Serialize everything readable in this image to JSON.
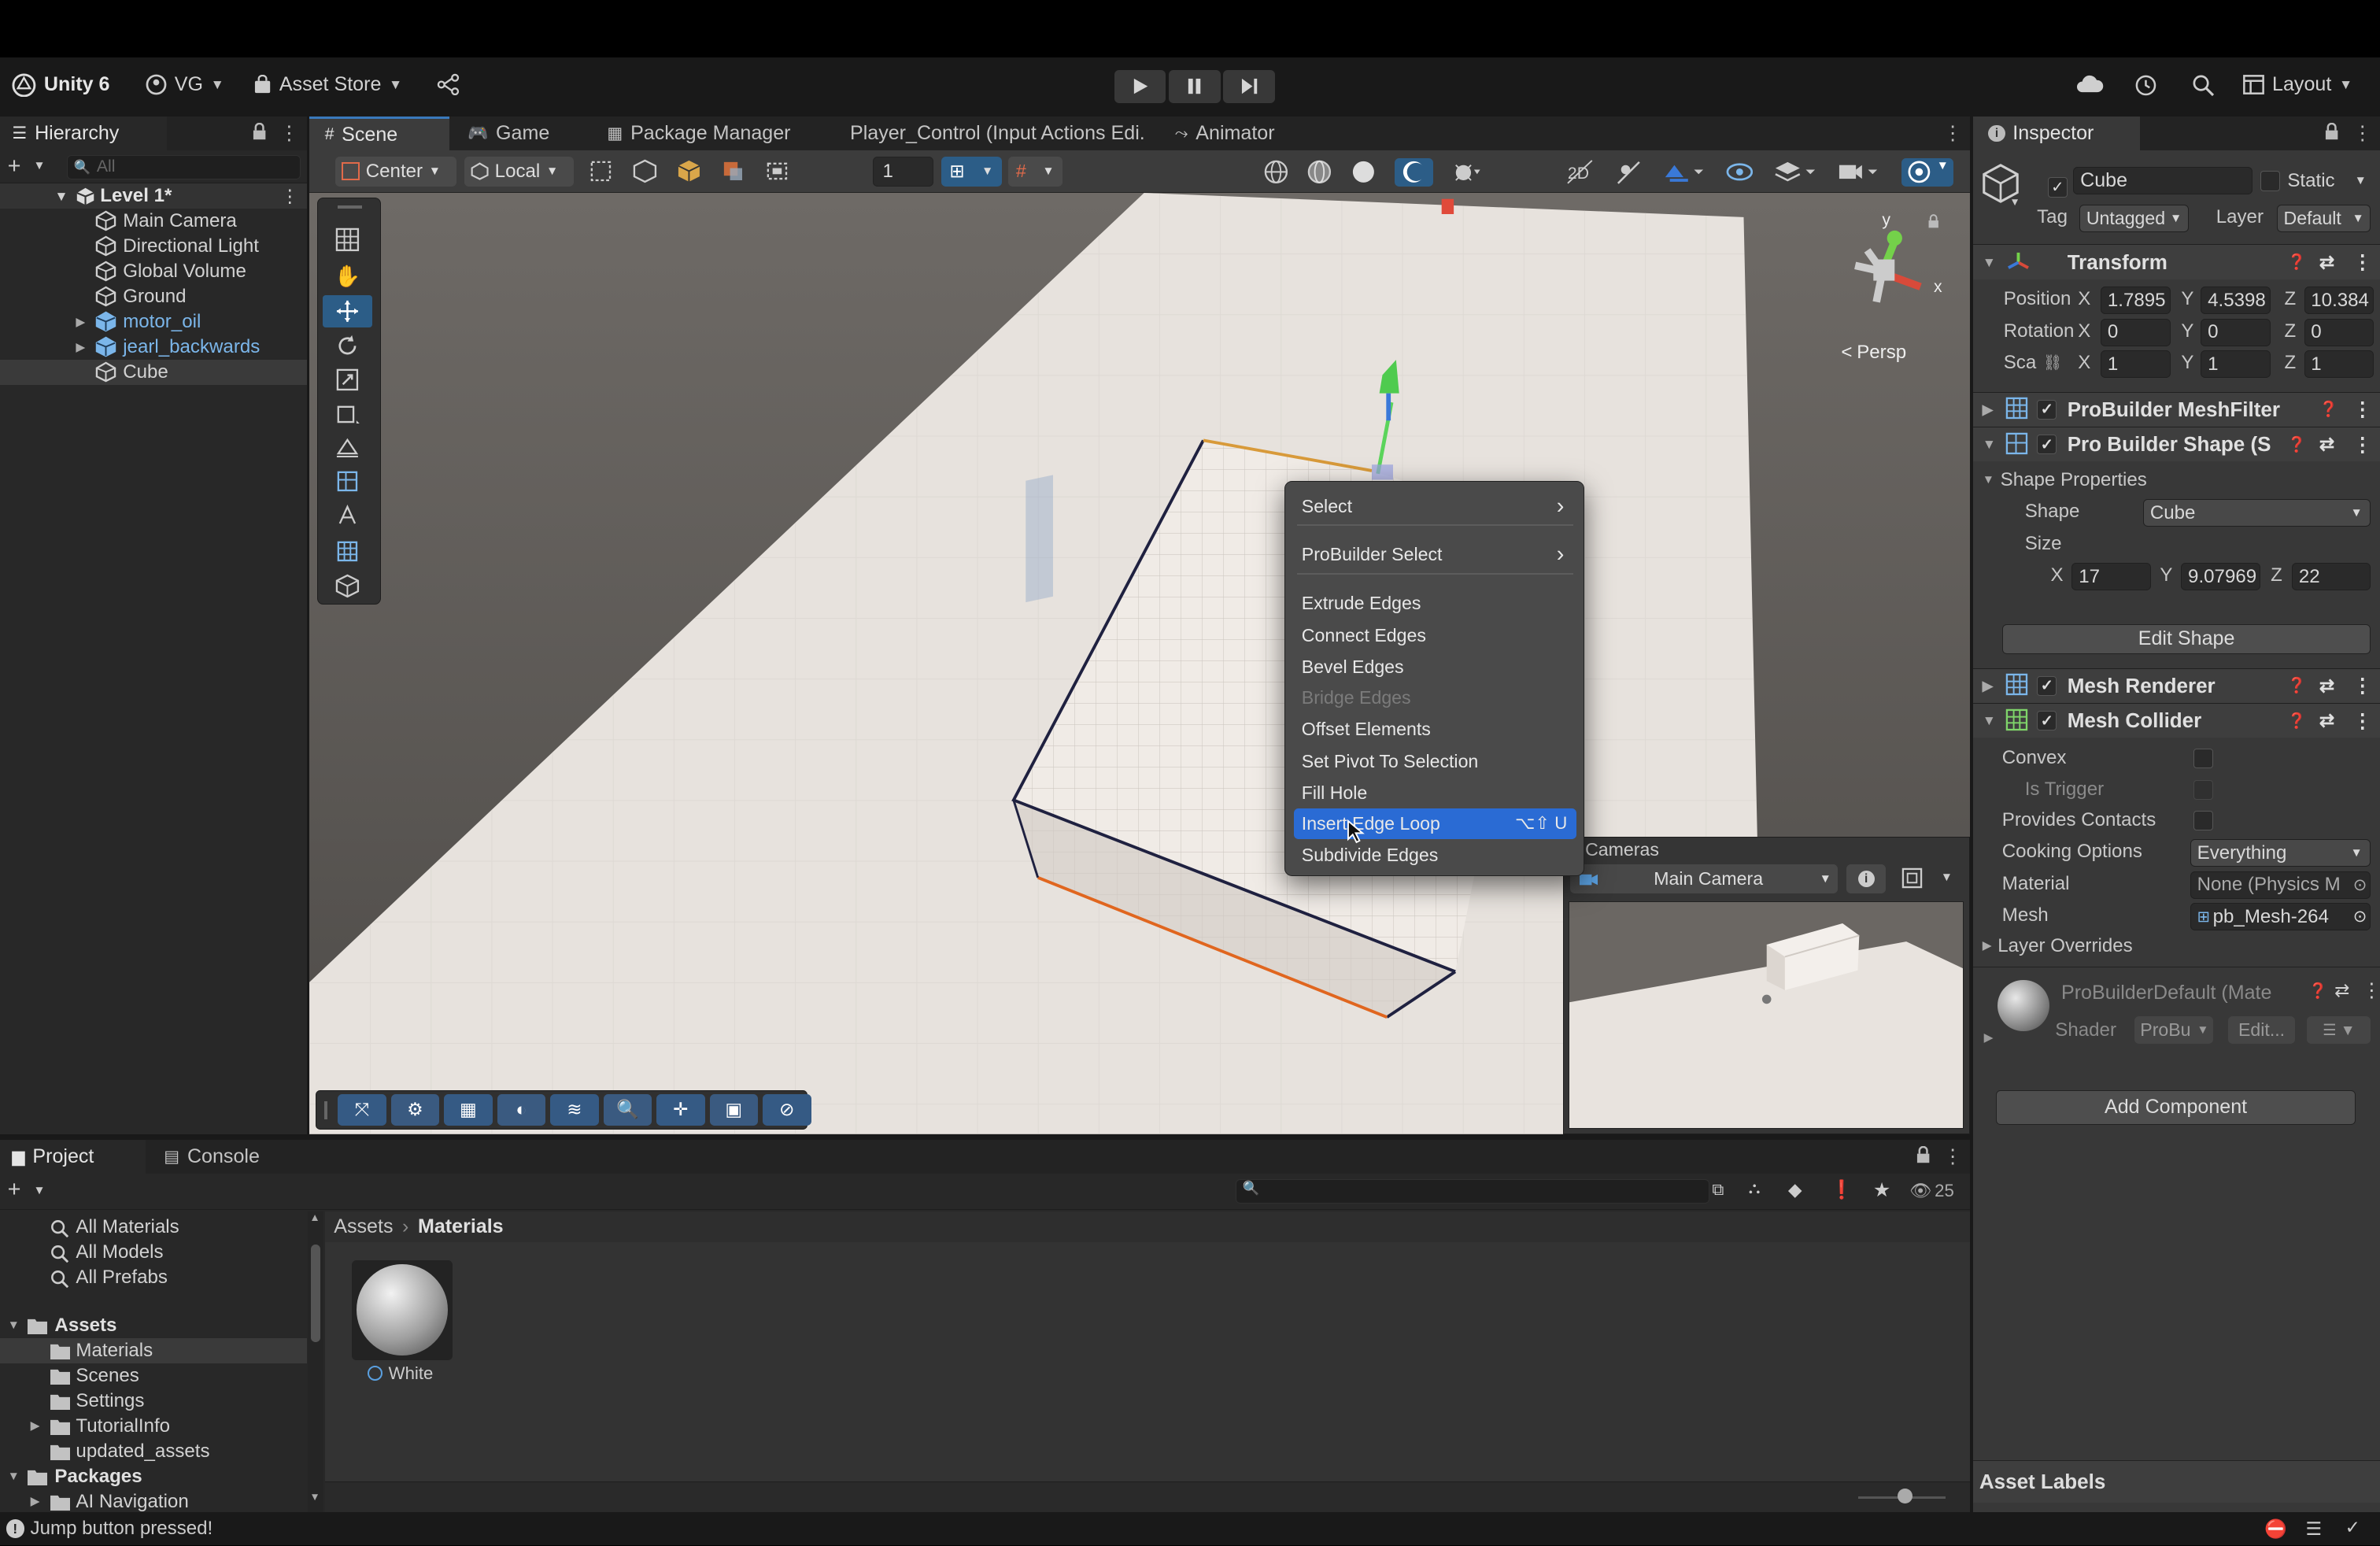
{
  "toolbar": {
    "unity": "Unity 6",
    "account": "VG",
    "asset_store": "Asset Store",
    "layout": "Layout"
  },
  "hierarchy": {
    "title": "Hierarchy",
    "search_placeholder": "All",
    "scene": "Level 1*",
    "items": [
      {
        "label": "Main Camera",
        "prefab": false,
        "expandable": false
      },
      {
        "label": "Directional Light",
        "prefab": false,
        "expandable": false
      },
      {
        "label": "Global Volume",
        "prefab": false,
        "expandable": false
      },
      {
        "label": "Ground",
        "prefab": false,
        "expandable": false
      },
      {
        "label": "motor_oil",
        "prefab": true,
        "expandable": true
      },
      {
        "label": "jearl_backwards",
        "prefab": true,
        "expandable": true
      },
      {
        "label": "Cube",
        "prefab": false,
        "expandable": false,
        "selected": true
      }
    ]
  },
  "tabs": [
    "Scene",
    "Game",
    "Package Manager",
    "Player_Control (Input Actions Edi.",
    "Animator"
  ],
  "scene_toolbar": {
    "pivot": "Center",
    "space": "Local",
    "snap_value": "1"
  },
  "scene": {
    "persp": "Persp",
    "axes": {
      "y": "y",
      "x": "x"
    }
  },
  "context_menu": {
    "items": [
      {
        "label": "Select",
        "submenu": true
      },
      {
        "label": "ProBuilder Select",
        "submenu": true
      },
      {
        "label": "Extrude Edges"
      },
      {
        "label": "Connect Edges"
      },
      {
        "label": "Bevel Edges"
      },
      {
        "label": "Bridge Edges",
        "disabled": true
      },
      {
        "label": "Offset Elements"
      },
      {
        "label": "Set Pivot To Selection"
      },
      {
        "label": "Fill Hole"
      },
      {
        "label": "Insert Edge Loop",
        "shortcut": "⌥⇧ U",
        "highlighted": true
      },
      {
        "label": "Subdivide Edges"
      }
    ]
  },
  "cameras_overlay": {
    "title": "Cameras",
    "camera": "Main Camera"
  },
  "inspector": {
    "title": "Inspector",
    "object_name": "Cube",
    "static": "Static",
    "tag_label": "Tag",
    "tag": "Untagged",
    "layer_label": "Layer",
    "layer": "Default",
    "transform": {
      "title": "Transform",
      "position_label": "Position",
      "rotation_label": "Rotation",
      "scale_label": "Sca",
      "position": {
        "x": "1.7895",
        "y": "4.5398",
        "z": "10.384"
      },
      "rotation": {
        "x": "0",
        "y": "0",
        "z": "0"
      },
      "scale": {
        "x": "1",
        "y": "1",
        "z": "1"
      }
    },
    "meshfilter": "ProBuilder MeshFilter",
    "pbshape": "Pro Builder Shape (S",
    "shape_properties": "Shape Properties",
    "shape_label": "Shape",
    "shape": "Cube",
    "size_label": "Size",
    "size": {
      "x": "17",
      "y": "9.07969",
      "z": "22"
    },
    "edit_shape": "Edit Shape",
    "mesh_renderer": "Mesh Renderer",
    "mesh_collider": "Mesh Collider",
    "convex": "Convex",
    "is_trigger": "Is Trigger",
    "provides_contacts": "Provides Contacts",
    "cooking_options_label": "Cooking Options",
    "cooking_options": "Everything",
    "material_label": "Material",
    "material": "None (Physics M",
    "mesh_label": "Mesh",
    "mesh": "pb_Mesh-264",
    "layer_overrides": "Layer Overrides",
    "material_name": "ProBuilderDefault (Mate",
    "shader_label": "Shader",
    "shader": "ProBu",
    "edit": "Edit...",
    "add_component": "Add Component",
    "asset_labels": "Asset Labels"
  },
  "project": {
    "tab_project": "Project",
    "tab_console": "Console",
    "favorites": [
      "All Materials",
      "All Models",
      "All Prefabs"
    ],
    "assets_root": "Assets",
    "assets": [
      {
        "label": "Materials",
        "selected": true,
        "expandable": false
      },
      {
        "label": "Scenes",
        "expandable": false
      },
      {
        "label": "Settings",
        "expandable": false
      },
      {
        "label": "TutorialInfo",
        "expandable": true
      },
      {
        "label": "updated_assets",
        "expandable": false
      }
    ],
    "packages_root": "Packages",
    "packages": [
      {
        "label": "AI Navigation",
        "expandable": true
      }
    ],
    "breadcrumb": [
      "Assets",
      "Materials"
    ],
    "asset_tile": "White",
    "visible_count": "25"
  },
  "status": {
    "message": "Jump button pressed!"
  },
  "colors": {
    "accent": "#2c5d87",
    "menu_highlight": "#2a6bd4",
    "prefab_blue": "#7bb6ea"
  }
}
